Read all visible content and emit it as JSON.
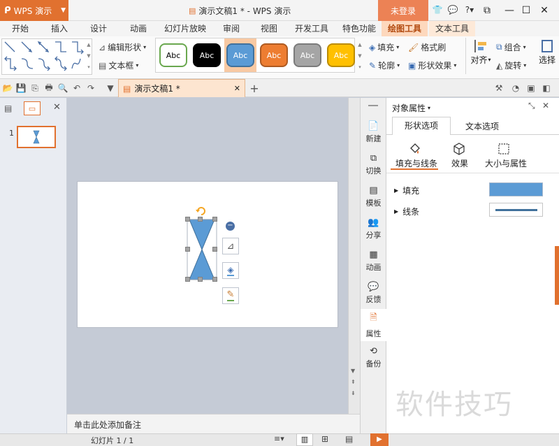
{
  "app": {
    "name": "WPS 演示",
    "doc_title": "演示文稿1 * - WPS 演示",
    "login": "未登录"
  },
  "tabs": [
    "开始",
    "插入",
    "设计",
    "动画",
    "幻灯片放映",
    "审阅",
    "视图",
    "开发工具",
    "特色功能",
    "绘图工具",
    "文本工具"
  ],
  "active_tab": "绘图工具",
  "ribbon": {
    "edit_shape": "编辑形状",
    "text_box": "文本框",
    "styles": [
      {
        "label": "Abc",
        "fill": "#ffffff",
        "border": "#6aa84f",
        "text": "#000000"
      },
      {
        "label": "Abc",
        "fill": "#000000",
        "border": "#000000",
        "text": "#ffffff"
      },
      {
        "label": "Abc",
        "fill": "#5b9bd5",
        "border": "#41719c",
        "text": "#ffffff"
      },
      {
        "label": "Abc",
        "fill": "#ed7d31",
        "border": "#ae5a21",
        "text": "#ffffff"
      },
      {
        "label": "Abc",
        "fill": "#a5a5a5",
        "border": "#7b7b7b",
        "text": "#ffffff"
      },
      {
        "label": "Abc",
        "fill": "#ffc000",
        "border": "#bc8c00",
        "text": "#ffffff"
      }
    ],
    "fill": "填充",
    "outline": "轮廓",
    "format_brush": "格式刷",
    "shape_effects": "形状效果",
    "align": "对齐",
    "group": "组合",
    "rotate": "旋转",
    "select": "选择"
  },
  "doc_tab": "演示文稿1 *",
  "slide_number": "1",
  "sidebar": [
    {
      "label": "新建",
      "icon": "new-icon"
    },
    {
      "label": "切换",
      "icon": "transition-icon"
    },
    {
      "label": "模板",
      "icon": "template-icon"
    },
    {
      "label": "分享",
      "icon": "share-icon"
    },
    {
      "label": "动画",
      "icon": "animation-icon"
    },
    {
      "label": "反馈",
      "icon": "feedback-icon"
    },
    {
      "label": "属性",
      "icon": "properties-icon"
    },
    {
      "label": "备份",
      "icon": "backup-icon"
    }
  ],
  "sidebar_active": "属性",
  "props": {
    "title": "对象属性",
    "tabs": [
      "形状选项",
      "文本选项"
    ],
    "subtabs": [
      "填充与线条",
      "效果",
      "大小与属性"
    ],
    "rows": [
      {
        "label": "填充"
      },
      {
        "label": "线条"
      }
    ],
    "fill_color": "#5b9bd5",
    "line_color": "#41719c"
  },
  "notes": "单击此处添加备注",
  "status": {
    "slide": "幻灯片 1 / 1"
  },
  "watermark": "软件技巧",
  "colors": {
    "accent": "#e1712f",
    "shape": "#5b9bd5",
    "rotate_handle": "#f5a623"
  }
}
